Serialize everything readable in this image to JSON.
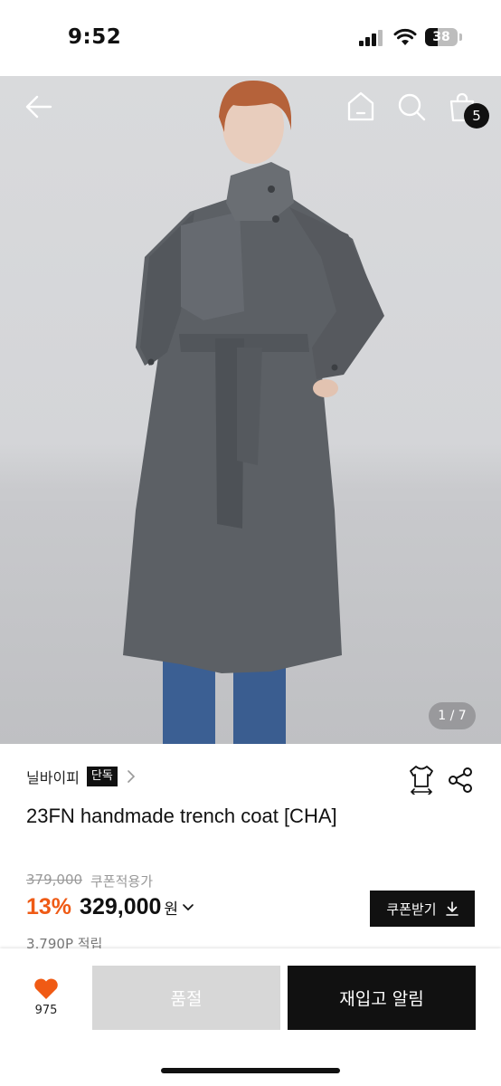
{
  "status_bar": {
    "time": "9:52",
    "battery_level": "38",
    "icons": [
      "signal-icon",
      "wifi-icon",
      "battery-icon"
    ]
  },
  "nav": {
    "icons": [
      "back-arrow-icon",
      "home-icon",
      "search-icon",
      "shopping-bag-icon"
    ],
    "cart_count": "5"
  },
  "gallery": {
    "page_indicator": "1 / 7"
  },
  "product": {
    "brand": "닐바이피",
    "exclusive_badge": "단독",
    "title": "23FN handmade trench coat [CHA]",
    "icons": [
      "size-guide-icon",
      "share-icon"
    ]
  },
  "pricing": {
    "original_price": "379,000",
    "coupon_note": "쿠폰적용가",
    "discount": "13%",
    "price": "329,000",
    "currency": "원",
    "coupon_button_label": "쿠폰받기",
    "points": "3,790P 적립"
  },
  "bottom_bar": {
    "like_count": "975",
    "soldout_label": "품절",
    "restock_label": "재입고 알림"
  },
  "colors": {
    "accent": "#ef5b16",
    "primary": "#111111",
    "soldout": "#d7d7d7",
    "heart": "#f05a14"
  }
}
